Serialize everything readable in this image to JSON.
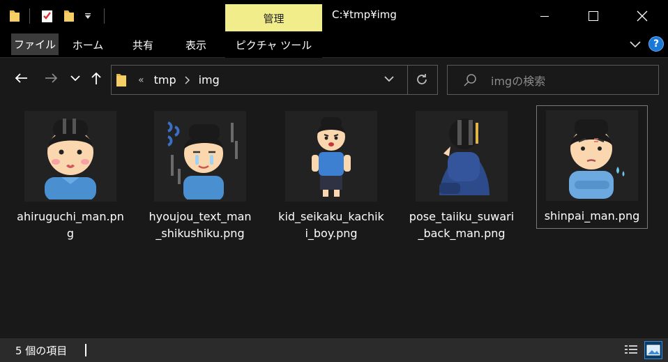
{
  "window": {
    "context_tab": "管理",
    "title": "C:¥tmp¥img"
  },
  "ribbon": {
    "tabs": [
      "ファイル",
      "ホーム",
      "共有",
      "表示",
      "ピクチャ ツール"
    ]
  },
  "nav": {
    "breadcrumb_prefix": "«",
    "breadcrumb": [
      "tmp",
      "img"
    ],
    "search_placeholder": "imgの検索"
  },
  "files": [
    {
      "name": "ahiruguchi_man.png",
      "icon": "man-pouting-image",
      "selected": false
    },
    {
      "name": "hyoujou_text_man_shikushiku.png",
      "icon": "man-crying-image",
      "selected": false
    },
    {
      "name": "kid_seikaku_kachiki_boy.png",
      "icon": "boy-determined-image",
      "selected": false
    },
    {
      "name": "pose_taiiku_suwari_back_man.png",
      "icon": "man-sitting-back-image",
      "selected": false
    },
    {
      "name": "shinpai_man.png",
      "icon": "man-worried-image",
      "selected": true
    }
  ],
  "status": {
    "item_count": "5 個の項目"
  },
  "colors": {
    "context_tab_bg": "#f1ed8a",
    "help_blue": "#1a78d6",
    "background": "#191919"
  }
}
